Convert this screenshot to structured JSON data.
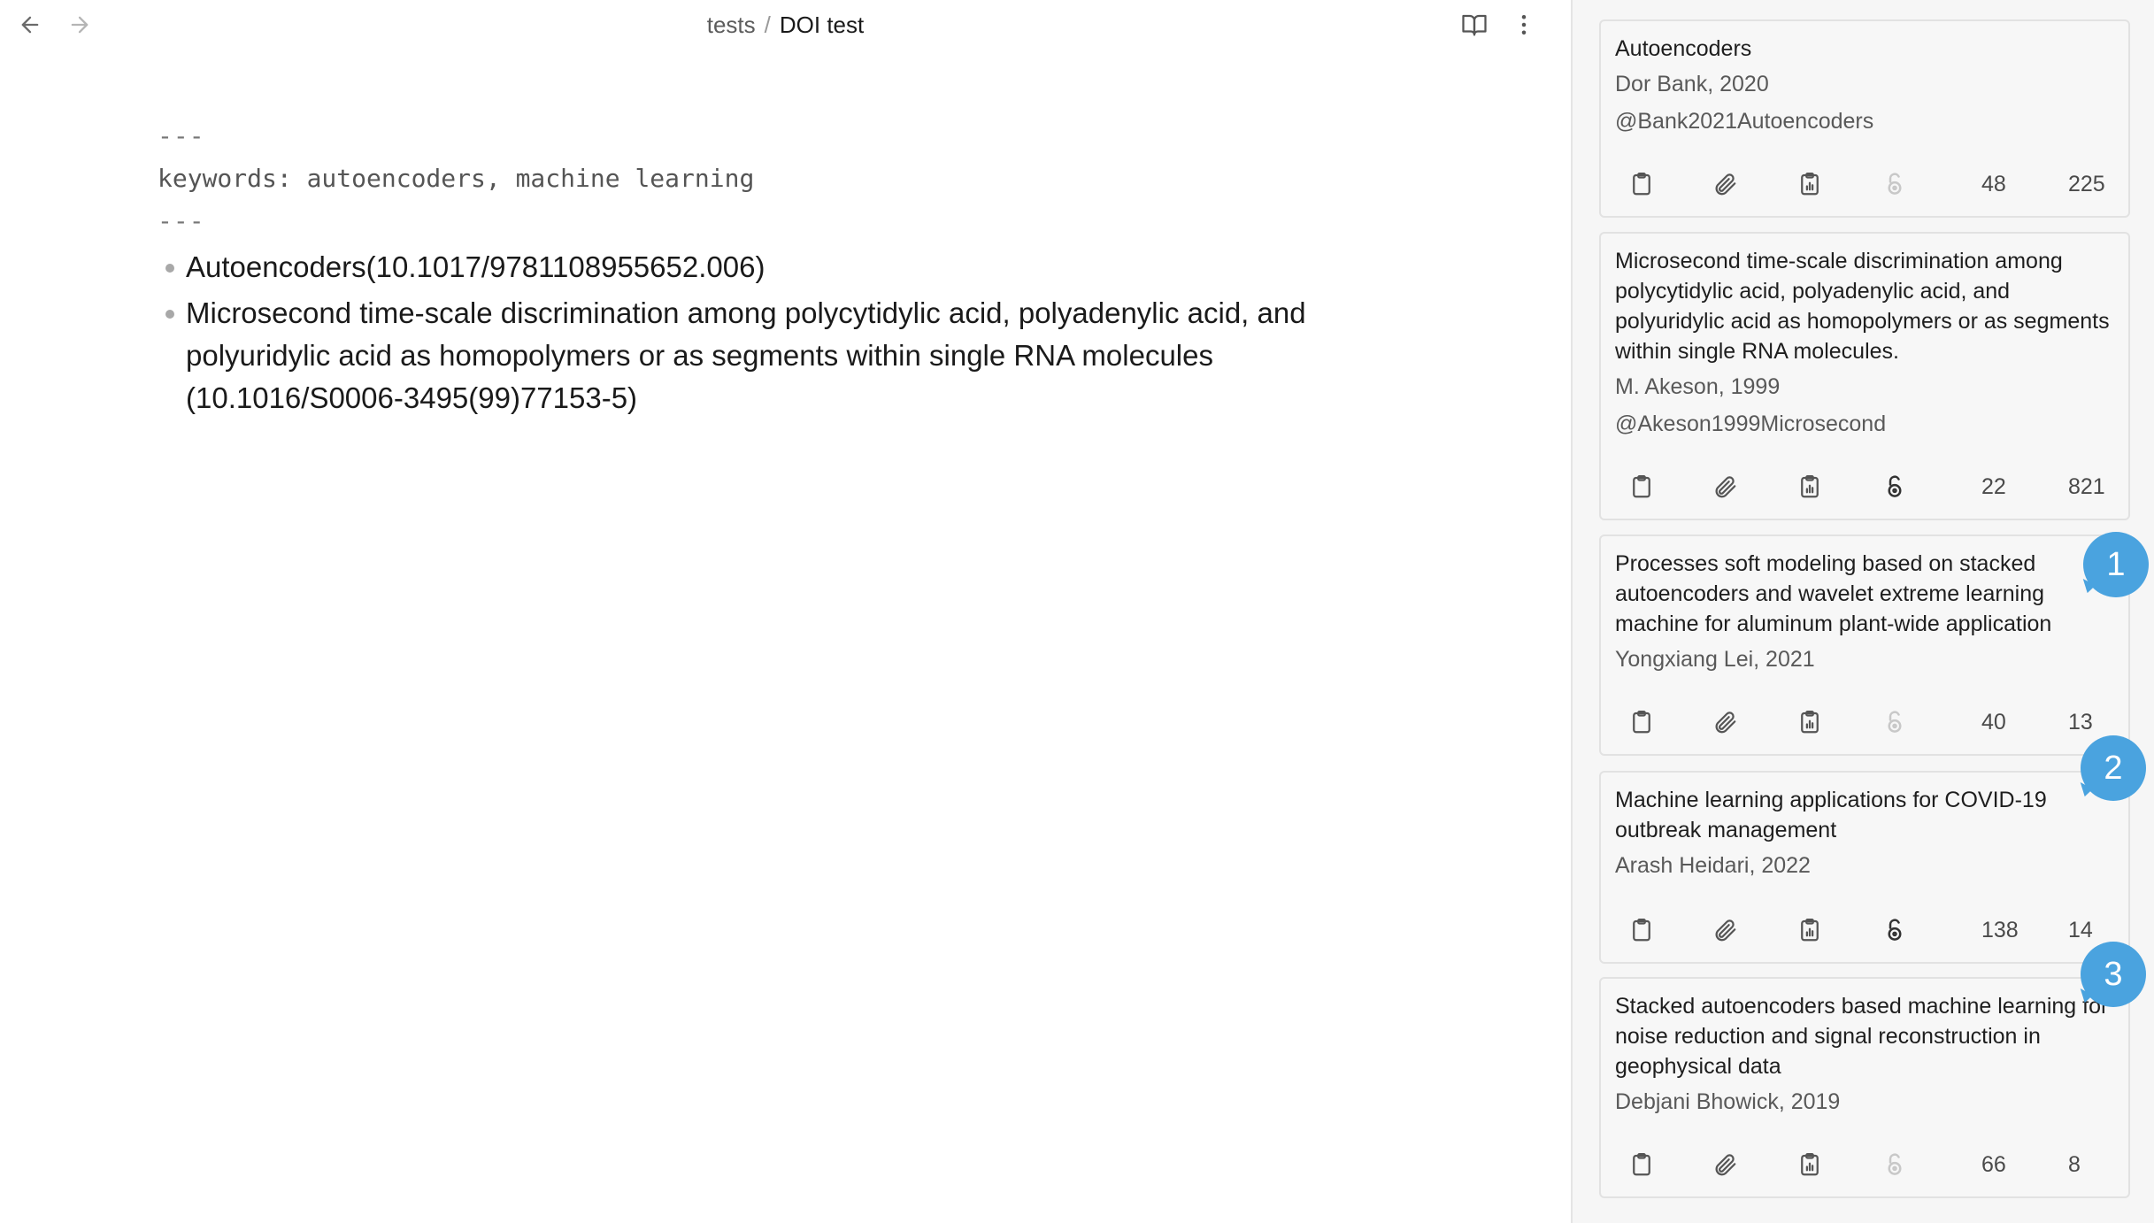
{
  "breadcrumb": {
    "parent": "tests",
    "separator": "/",
    "current": "DOI test"
  },
  "icons": {
    "back": "arrow-left-icon",
    "forward": "arrow-right-icon",
    "reading_view": "book-open-icon",
    "more": "more-vertical-icon",
    "copy": "clipboard-icon",
    "attach": "paperclip-icon",
    "report": "clipboard-chart-icon",
    "open_access": "lock-open-icon"
  },
  "editor": {
    "frontmatter_open": "---",
    "frontmatter_line": "keywords: autoencoders, machine learning",
    "frontmatter_close": "---",
    "items": [
      "Autoencoders(10.1017/9781108955652.006)",
      "Microsecond time-scale discrimination among polycytidylic acid, polyadenylic acid, and polyuridylic acid as homopolymers or as segments within single RNA molecules (10.1016/S0006-3495(99)77153-5)"
    ]
  },
  "colors": {
    "badge": "#4aa3df",
    "open_access_active": "#333333",
    "open_access_inactive": "#c8c8c8",
    "icon": "#555555"
  },
  "cards": [
    {
      "title": "Autoencoders",
      "author_year": "Dor Bank, 2020",
      "citekey": "@Bank2021Autoencoders",
      "open_access": false,
      "references": "48",
      "citations": "225"
    },
    {
      "title": "Microsecond time-scale discrimination among polycytidylic acid, polyadenylic acid, and polyuridylic acid as homopolymers or as segments within single RNA molecules.",
      "author_year": "M. Akeson, 1999",
      "citekey": "@Akeson1999Microsecond",
      "open_access": true,
      "references": "22",
      "citations": "821"
    },
    {
      "title": "Processes soft modeling based on stacked autoencoders and wavelet extreme learning machine for aluminum plant-wide application",
      "author_year": "Yongxiang Lei, 2021",
      "citekey": "",
      "open_access": false,
      "references": "40",
      "citations": "13"
    },
    {
      "title": "Machine learning applications for COVID-19 outbreak management",
      "author_year": "Arash Heidari, 2022",
      "citekey": "",
      "open_access": true,
      "references": "138",
      "citations": "14"
    },
    {
      "title": "Stacked autoencoders based machine learning for noise reduction and signal reconstruction in geophysical data",
      "author_year": "Debjani Bhowick, 2019",
      "citekey": "",
      "open_access": false,
      "references": "66",
      "citations": "8"
    }
  ],
  "badges": [
    "1",
    "2",
    "3"
  ]
}
